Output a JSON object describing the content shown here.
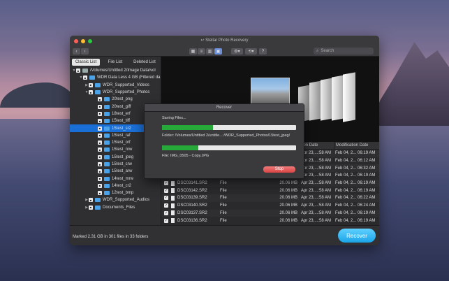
{
  "window": {
    "title": "Stellar Photo Recovery"
  },
  "toolbar": {
    "search_placeholder": "Search"
  },
  "sidebar": {
    "tabs": [
      {
        "label": "Classic List",
        "active": true
      },
      {
        "label": "File List",
        "active": false
      },
      {
        "label": "Deleted List",
        "active": false
      }
    ],
    "tree": [
      {
        "label": "/Volumes/Untitled 2/Image Data/vol",
        "level": 0,
        "type": "folder-root",
        "expanded": true
      },
      {
        "label": "WDR Data Less 4 GB (Filtered da",
        "level": 1,
        "type": "folder",
        "expanded": true
      },
      {
        "label": "WDR_Supported_Videos",
        "level": 2,
        "type": "folder",
        "expanded": false
      },
      {
        "label": "WDR_Supported_Photos",
        "level": 2,
        "type": "folder",
        "expanded": true
      },
      {
        "label": "20test_png",
        "level": 3,
        "type": "folder"
      },
      {
        "label": "20test_giff",
        "level": 3,
        "type": "folder"
      },
      {
        "label": "18test_erf",
        "level": 3,
        "type": "folder"
      },
      {
        "label": "15test_tiff",
        "level": 3,
        "type": "folder"
      },
      {
        "label": "15test_sr2",
        "level": 3,
        "type": "folder",
        "selected": true
      },
      {
        "label": "15test_raf",
        "level": 3,
        "type": "folder"
      },
      {
        "label": "15test_orf",
        "level": 3,
        "type": "folder"
      },
      {
        "label": "15test_nrw",
        "level": 3,
        "type": "folder"
      },
      {
        "label": "15test_jpeg",
        "level": 3,
        "type": "folder"
      },
      {
        "label": "15test_crw",
        "level": 3,
        "type": "folder"
      },
      {
        "label": "15test_arw",
        "level": 3,
        "type": "folder"
      },
      {
        "label": "14test_mrw",
        "level": 3,
        "type": "folder"
      },
      {
        "label": "14test_cr2",
        "level": 3,
        "type": "folder"
      },
      {
        "label": "12test_bmp",
        "level": 3,
        "type": "folder"
      },
      {
        "label": "WDR_Supported_Audios",
        "level": 2,
        "type": "folder",
        "expanded": false
      },
      {
        "label": "Documents_Files",
        "level": 2,
        "type": "folder",
        "expanded": false
      }
    ]
  },
  "table": {
    "columns": {
      "modified": "Modification Date",
      "created_partial": "ation Date"
    },
    "rows": [
      {
        "name": "",
        "type": "",
        "size": "",
        "created": "Apr 23,...:58 AM",
        "modified": "Feb 04, 2... 06:19 AM"
      },
      {
        "name": "",
        "type": "",
        "size": "",
        "created": "Apr 23,...:58 AM",
        "modified": "Feb 04, 2... 06:12 AM"
      },
      {
        "name": "",
        "type": "",
        "size": "",
        "created": "Apr 23,...:58 AM",
        "modified": "Feb 04, 2... 06:32 AM"
      },
      {
        "name": "",
        "type": "",
        "size": "",
        "created": "Apr 23,...:58 AM",
        "modified": "Feb 04, 2... 06:19 AM"
      },
      {
        "name": "DSC03141.SR2",
        "type": "File",
        "size": "20.06 MB",
        "created": "Apr 23,...:58 AM",
        "modified": "Feb 04, 2... 06:19 AM"
      },
      {
        "name": "DSC03142.SR2",
        "type": "File",
        "size": "20.06 MB",
        "created": "Apr 23,...:58 AM",
        "modified": "Feb 04, 2... 06:19 AM"
      },
      {
        "name": "DSC03139.SR2",
        "type": "File",
        "size": "20.06 MB",
        "created": "Apr 23,...:58 AM",
        "modified": "Feb 04, 2... 06:22 AM"
      },
      {
        "name": "DSC03140.SR2",
        "type": "File",
        "size": "20.06 MB",
        "created": "Apr 23,...:58 AM",
        "modified": "Feb 04, 2... 06:24 AM"
      },
      {
        "name": "DSC03137.SR2",
        "type": "File",
        "size": "20.06 MB",
        "created": "Apr 23,...:58 AM",
        "modified": "Feb 04, 2... 06:19 AM"
      },
      {
        "name": "DSC03136.SR2",
        "type": "File",
        "size": "20.06 MB",
        "created": "Apr 23,...:58 AM",
        "modified": "Feb 04, 2... 06:19 AM"
      }
    ]
  },
  "status": {
    "text": "Marked 2.31 GB in 301 files in 33 folders",
    "recover_label": "Recover"
  },
  "dialog": {
    "title": "Recover",
    "saving_label": "Saving Files...",
    "folder_text": "Folder: /Volumes/Untitled 2/untitle...:/WDR_Supported_Photos/15test_jpeg/",
    "file_text": "File: IMG_0505 - Copy.JPG",
    "progress_overall": 0.38,
    "progress_file": 0.27,
    "stop_label": "Stop"
  },
  "colors": {
    "selection": "#1a6fd6",
    "progress": "#27a93a",
    "recover": "#1aa4e8",
    "stop": "#d84444"
  }
}
